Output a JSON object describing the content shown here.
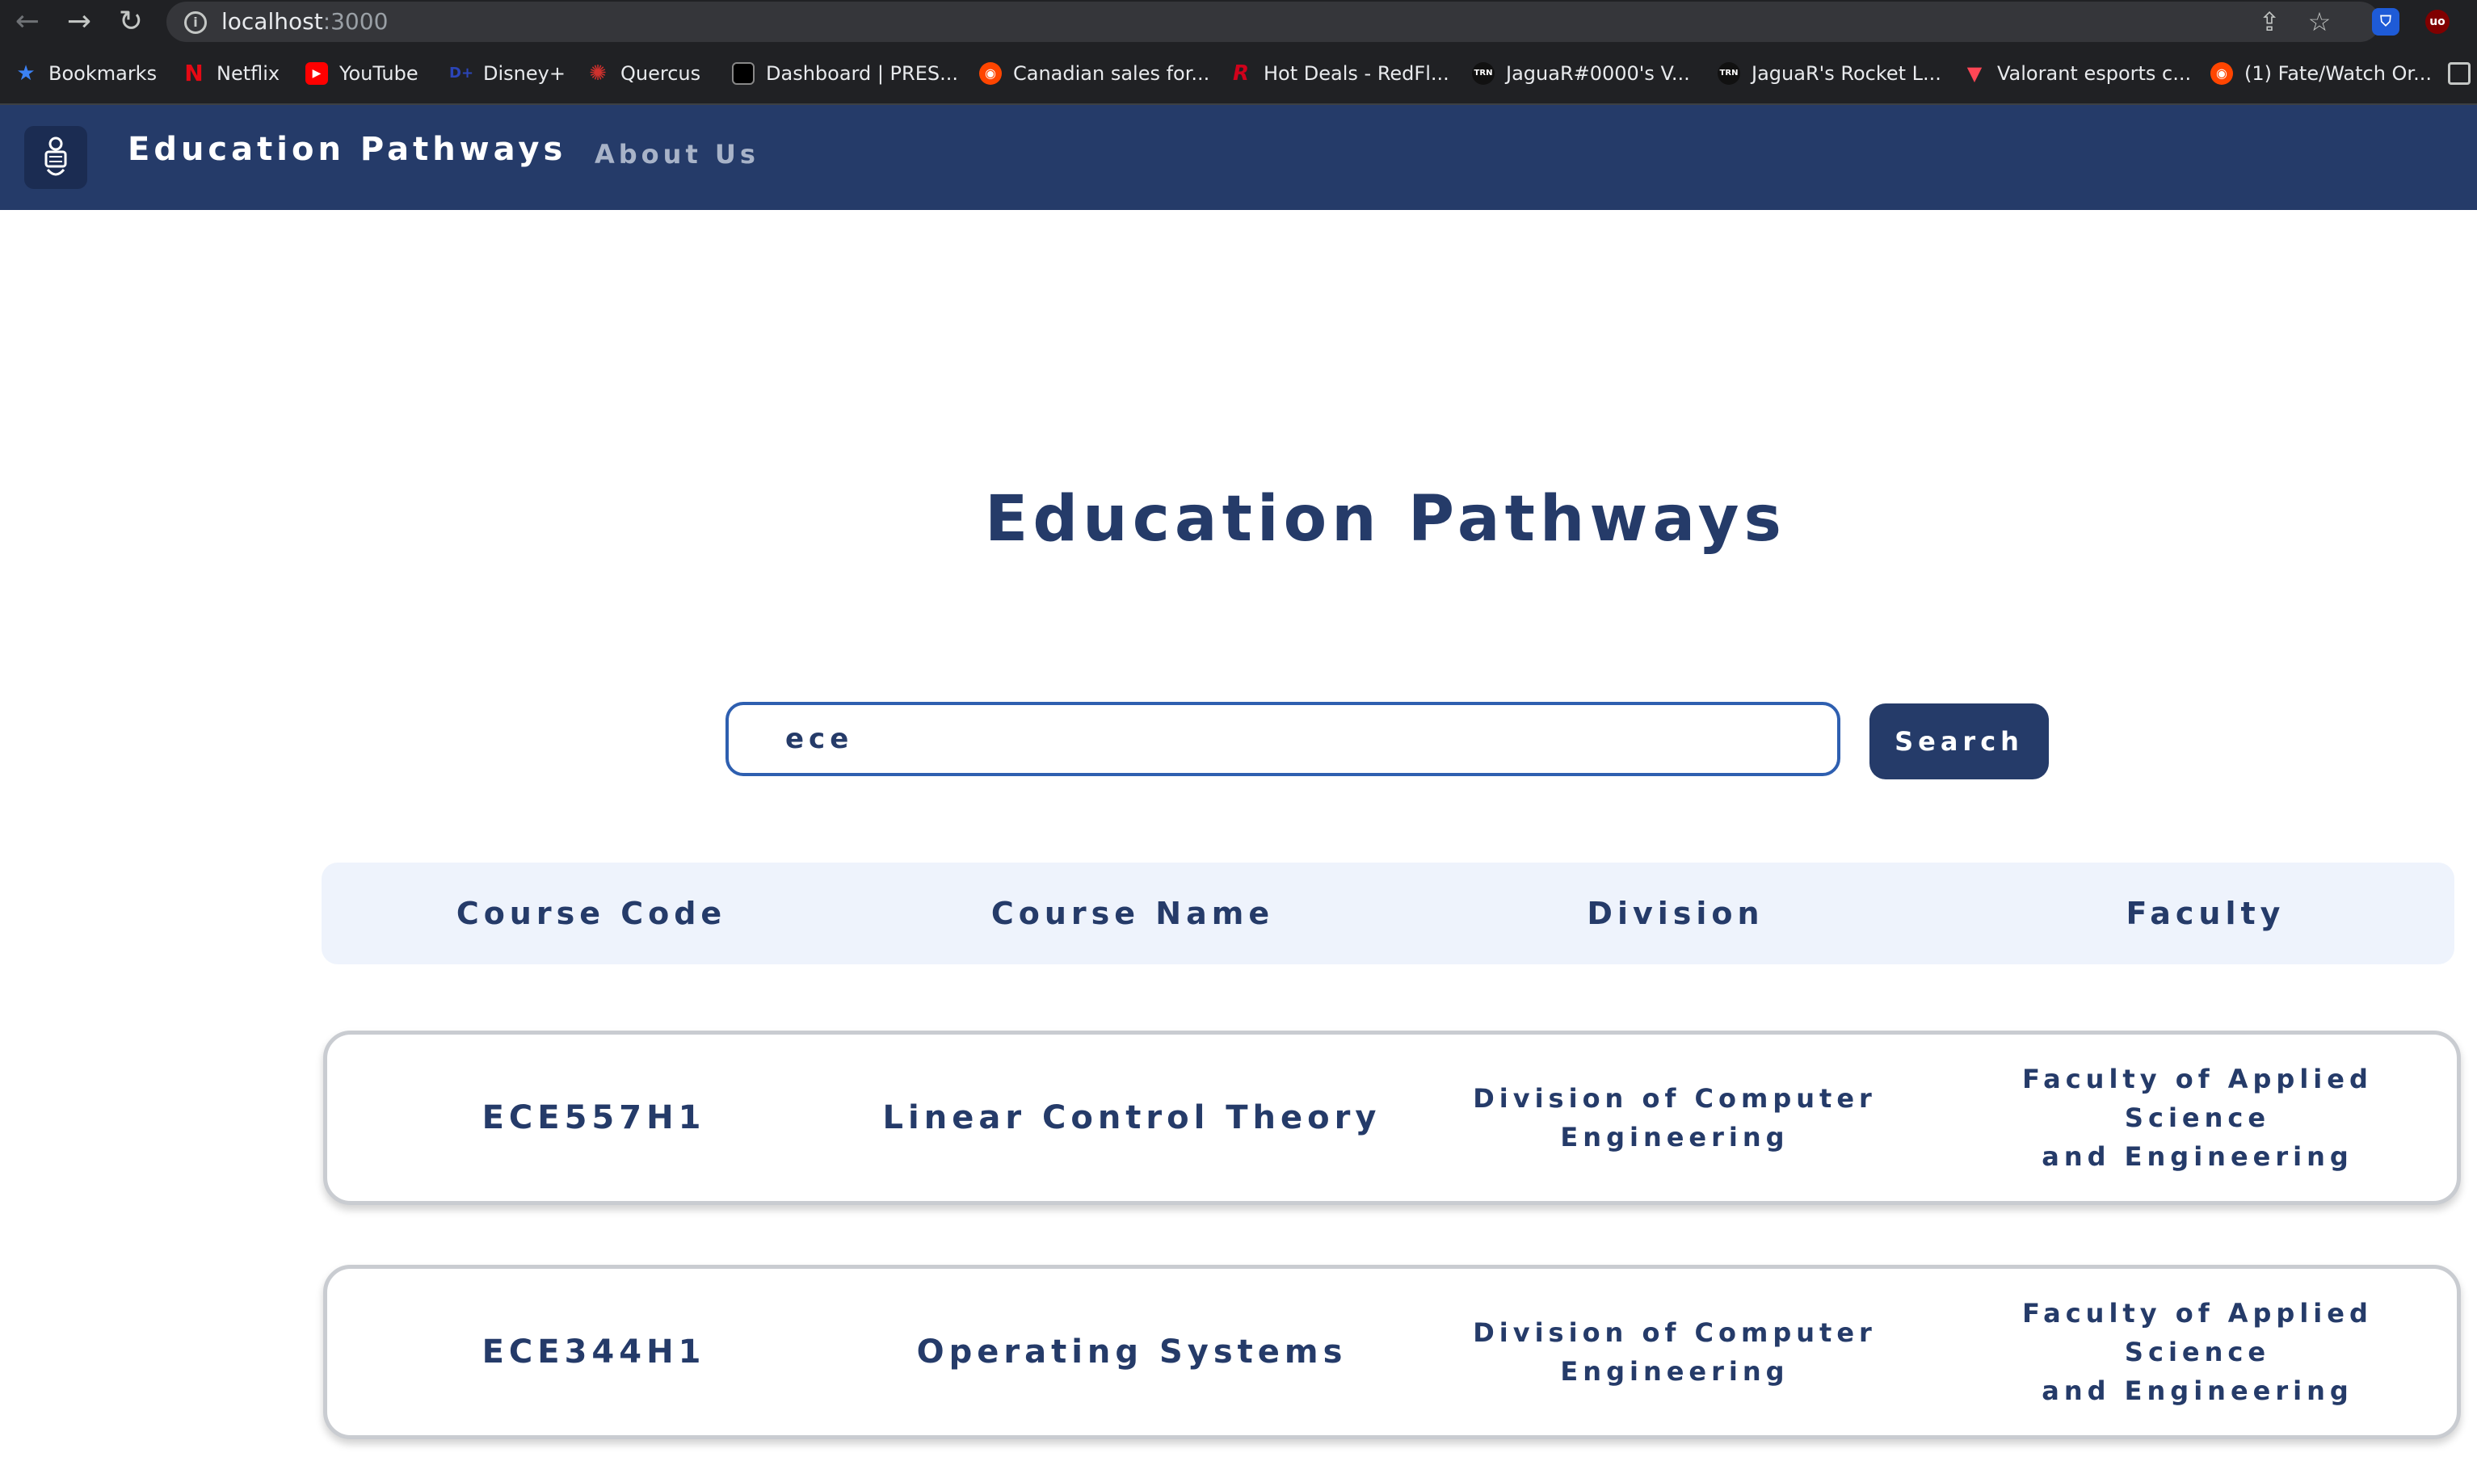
{
  "browser": {
    "url_host": "localhost",
    "url_port": ":3000",
    "bookmarks": [
      {
        "label": "Bookmarks",
        "icon": "star-icon",
        "color": "#3b82f6"
      },
      {
        "label": "Netflix",
        "icon": "netflix-icon",
        "color": "#e50914"
      },
      {
        "label": "YouTube",
        "icon": "youtube-icon",
        "color": "#ff0000"
      },
      {
        "label": "Disney+",
        "icon": "disney-icon",
        "color": "#1f3fa0"
      },
      {
        "label": "Quercus",
        "icon": "quercus-icon",
        "color": "#d0312d"
      },
      {
        "label": "Dashboard | PRES...",
        "icon": "dashboard-icon",
        "color": "#000000"
      },
      {
        "label": "Canadian sales for...",
        "icon": "reddit-icon",
        "color": "#ff4500"
      },
      {
        "label": "Hot Deals - RedFl...",
        "icon": "redflagdeals-icon",
        "color": "#d0021b"
      },
      {
        "label": "JaguaR#0000's V...",
        "icon": "tracker-icon",
        "color": "#111111"
      },
      {
        "label": "JaguaR's Rocket L...",
        "icon": "tracker-icon",
        "color": "#111111"
      },
      {
        "label": "Valorant esports c...",
        "icon": "valorant-icon",
        "color": "#ff4655"
      },
      {
        "label": "(1) Fate/Watch Or...",
        "icon": "reddit-icon",
        "color": "#ff4500"
      }
    ]
  },
  "header": {
    "brand": "Education Pathways",
    "nav_about": "About Us"
  },
  "main": {
    "title": "Education Pathways",
    "search": {
      "value": "ece",
      "button_label": "Search"
    },
    "table": {
      "columns": [
        "Course Code",
        "Course Name",
        "Division",
        "Faculty"
      ],
      "rows": [
        {
          "code": "ECE557H1",
          "name": "Linear Control Theory",
          "division_line1": "Division of Computer",
          "division_line2": "Engineering",
          "faculty_line1": "Faculty of Applied Science",
          "faculty_line2": "and Engineering"
        },
        {
          "code": "ECE344H1",
          "name": "Operating Systems",
          "division_line1": "Division of Computer",
          "division_line2": "Engineering",
          "faculty_line1": "Faculty of Applied Science",
          "faculty_line2": "and Engineering"
        }
      ]
    }
  },
  "colors": {
    "brand": "#253b69",
    "header_bg": "#253b69",
    "table_header_bg": "#eef3fc",
    "input_border": "#2e5fb0"
  }
}
